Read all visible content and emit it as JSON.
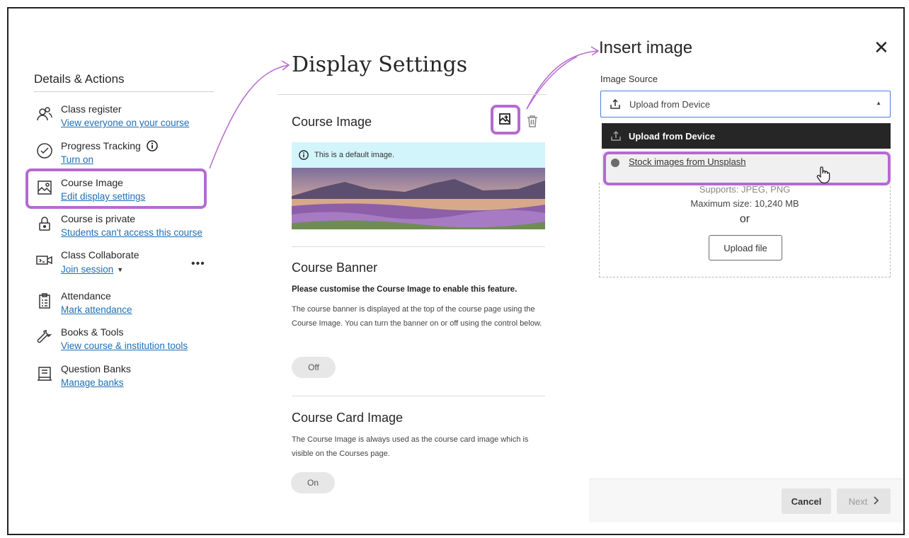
{
  "left": {
    "title": "Details & Actions",
    "items": [
      {
        "label": "Class register",
        "link": "View everyone on your course",
        "icon": "users-icon"
      },
      {
        "label": "Progress Tracking",
        "link": "Turn on",
        "icon": "check-circle-icon"
      },
      {
        "label": "Course Image",
        "link": "Edit display settings",
        "icon": "image-icon"
      },
      {
        "label": "Course is private",
        "link": "Students can't access this course",
        "icon": "lock-icon"
      },
      {
        "label": "Class Collaborate",
        "link": "Join session",
        "icon": "video-icon"
      },
      {
        "label": "Attendance",
        "link": "Mark attendance",
        "icon": "clipboard-icon"
      },
      {
        "label": "Books & Tools",
        "link": "View course & institution tools",
        "icon": "wrench-icon"
      },
      {
        "label": "Question Banks",
        "link": "Manage banks",
        "icon": "question-bank-icon"
      }
    ],
    "more": "•••"
  },
  "middle": {
    "title": "Display Settings",
    "course_image": {
      "title": "Course Image",
      "default_note": "This is a default image."
    },
    "course_banner": {
      "title": "Course Banner",
      "bold_note": "Please customise the Course Image to enable this feature.",
      "description": "The course banner is displayed at the top of the course page using the Course Image. You can turn the banner on or off using the control below.",
      "toggle": "Off"
    },
    "course_card": {
      "title": "Course Card Image",
      "description": "The Course Image is always used as the course card image which is visible on the Courses page.",
      "toggle": "On"
    }
  },
  "right": {
    "title": "Insert image",
    "close": "✕",
    "source_label": "Image Source",
    "selected": "Upload from Device",
    "options": [
      "Upload from Device",
      "Stock images from Unsplash"
    ],
    "supports": "Supports: JPEG, PNG",
    "max_size": "Maximum size: 10,240 MB",
    "or": "or",
    "upload_button": "Upload file",
    "cancel": "Cancel",
    "next": "Next"
  },
  "colors": {
    "highlight": "#b66ad1",
    "link": "#1f6fb5",
    "accent": "#4b7ee0"
  }
}
